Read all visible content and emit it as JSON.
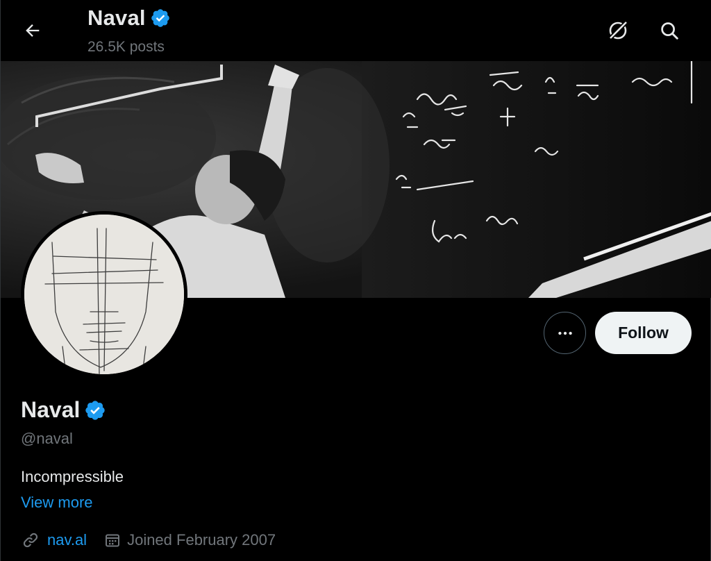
{
  "header": {
    "title": "Naval",
    "posts_count": "26.5K posts"
  },
  "profile": {
    "name": "Naval",
    "handle": "@naval",
    "bio": "Incompressible",
    "view_more_label": "View more",
    "website": "nav.al",
    "joined": "Joined February 2007",
    "verified": true
  },
  "actions": {
    "follow_label": "Follow",
    "more_label": "•••"
  },
  "icons": {
    "back": "arrow-left-icon",
    "grok": "grok-icon",
    "search": "search-icon",
    "verified": "verified-badge-icon",
    "link": "link-icon",
    "calendar": "calendar-icon"
  },
  "colors": {
    "accent": "#1d9bf0",
    "background": "#000000",
    "text_primary": "#e7e9ea",
    "text_secondary": "#71767b",
    "follow_bg": "#eff3f4"
  }
}
